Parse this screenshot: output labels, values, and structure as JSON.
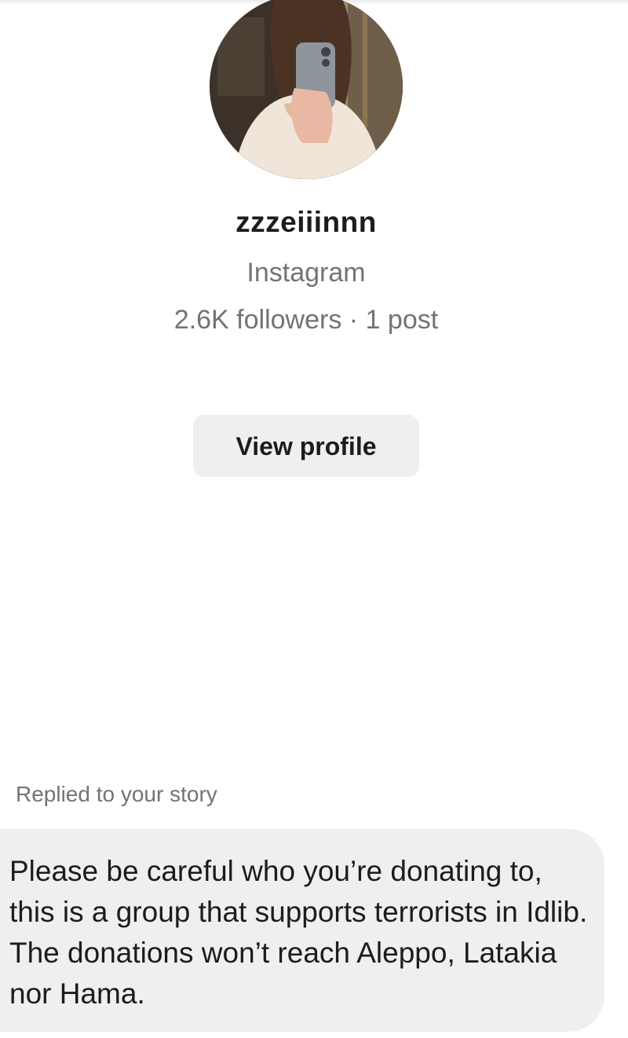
{
  "profile": {
    "username": "zzzeiiinnn",
    "platform": "Instagram",
    "stats": "2.6K followers · 1 post",
    "view_profile_label": "View profile",
    "avatar_icon": "profile-photo"
  },
  "message": {
    "reply_label": "Replied to your story",
    "text": "Please be careful who you’re donating to, this is a group that supports terrorists in Idlib. The donations won’t reach Aleppo, Latakia nor Hama."
  },
  "colors": {
    "background": "#ffffff",
    "button_bg": "#efefef",
    "bubble_bg": "#efefef",
    "muted_text": "#737373",
    "primary_text": "#1c1c1c"
  }
}
